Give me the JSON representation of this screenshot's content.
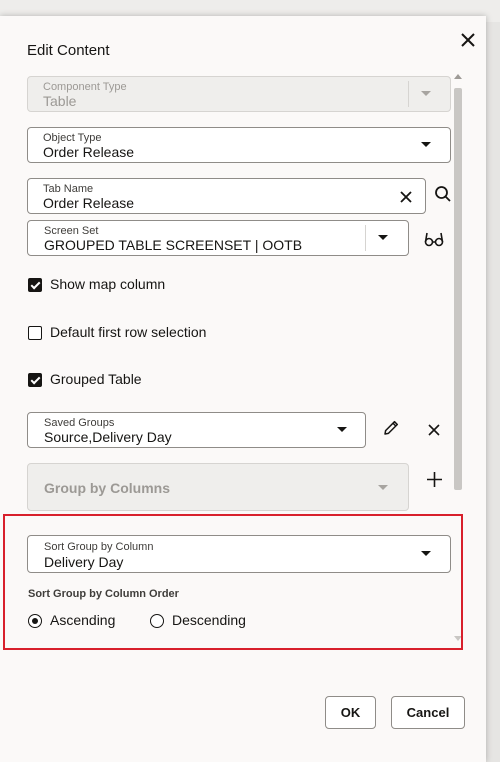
{
  "dialog": {
    "title": "Edit Content",
    "component_type": {
      "label": "Component Type",
      "value": "Table"
    },
    "object_type": {
      "label": "Object Type",
      "value": "Order Release"
    },
    "tab_name": {
      "label": "Tab Name",
      "value": "Order Release"
    },
    "screen_set": {
      "label": "Screen Set",
      "value": "GROUPED TABLE SCREENSET | OOTB"
    },
    "checkboxes": [
      {
        "label": "Show map column",
        "checked": true
      },
      {
        "label": "Default first row selection",
        "checked": false
      },
      {
        "label": "Grouped Table",
        "checked": true
      }
    ],
    "saved_groups": {
      "label": "Saved Groups",
      "value": "Source,Delivery Day"
    },
    "group_by_columns": {
      "placeholder": "Group by Columns"
    },
    "sort_group_by_column": {
      "label": "Sort Group by Column",
      "value": "Delivery Day"
    },
    "sort_order": {
      "label": "Sort Group by Column Order",
      "options": [
        {
          "label": "Ascending",
          "selected": true
        },
        {
          "label": "Descending",
          "selected": false
        }
      ]
    },
    "buttons": {
      "ok": "OK",
      "cancel": "Cancel"
    }
  },
  "colors": {
    "highlight": "#d8202c",
    "text": "#161513",
    "disabled_text": "#9c9995"
  },
  "icons": [
    "close-icon",
    "chevron-down-icon",
    "clear-icon",
    "search-icon",
    "glasses-icon",
    "pencil-icon",
    "plus-icon"
  ]
}
